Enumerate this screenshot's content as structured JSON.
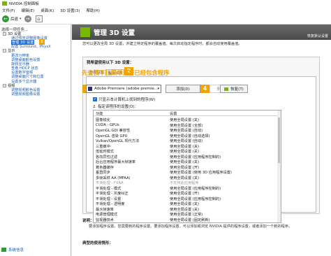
{
  "window": {
    "title": "NVIDIA 控制面板"
  },
  "menu": [
    "文件(F)",
    "编辑(E)",
    "桌面(K)",
    "3D 设置(3)",
    "帮助(H)"
  ],
  "toolbar": {
    "back_label": "后退",
    "forward_arrow": "→",
    "back_arrow": "←"
  },
  "sidebar": {
    "task_label": "选择一项任务...",
    "items": [
      {
        "type": "cat",
        "label": "3D 设置",
        "toggle": "−"
      },
      {
        "type": "child",
        "label": "通过预览调整图像设置"
      },
      {
        "type": "child",
        "label": "管理 3D 设置",
        "selected": true,
        "badge": "1"
      },
      {
        "type": "child",
        "label": "配置 Surround、PhysX"
      },
      {
        "type": "cat",
        "label": "显示",
        "toggle": "−"
      },
      {
        "type": "child",
        "label": "更改分辨率"
      },
      {
        "type": "child",
        "label": "调整桌面颜色设置"
      },
      {
        "type": "child",
        "label": "旋转显示器"
      },
      {
        "type": "child",
        "label": "查看 HDCP 状态"
      },
      {
        "type": "child",
        "label": "设置数字音频"
      },
      {
        "type": "child",
        "label": "调整桌面尺寸和位置"
      },
      {
        "type": "child",
        "label": "设置多个显示器"
      },
      {
        "type": "cat",
        "label": "视频",
        "toggle": "−"
      },
      {
        "type": "child",
        "label": "调整视频颜色设置"
      },
      {
        "type": "child",
        "label": "调整视频图像设置"
      }
    ],
    "system_info": "系统信息"
  },
  "main": {
    "title": "管理 3D 设置",
    "restore_default": "恢复默认设置",
    "description": "您可以更改全局 3D 设置，并建立特定程序的覆盖值。每次启动指定程序时，都会自动使用覆盖值。",
    "panel_heading": "我希望使用以下 3D 设置：",
    "tabs": [
      "全局设置",
      "程序设置"
    ],
    "badges": {
      "tab": "2",
      "select": "3",
      "add": "4"
    },
    "step_text": "先查找下拉菜单是否已经包含程序",
    "select_label": "1. 选择要自定义的程序：",
    "program": "Adobe Premiere (adobe premie...",
    "add_button": "添加(D)",
    "remove_button": "删除(R)",
    "restore_button": "恢复(T)",
    "show_only_checkbox": "只显示本计算机上找到的程序(W)",
    "spec_label": "2. 指定该程序的设置(O)：",
    "table_headers": [
      "功能",
      "设置"
    ],
    "rows": [
      {
        "feature": "图像锐化",
        "setting": "使用全局设置 (关)"
      },
      {
        "feature": "CUDA - GPUs",
        "setting": "使用全局设置 (全部)"
      },
      {
        "feature": "OpenGL GDI 兼容性",
        "setting": "使用全局设置 (自动)"
      },
      {
        "feature": "OpenGL 渲染 GPU",
        "setting": "使用全局设置 (自动选择)"
      },
      {
        "feature": "Vulkan/OpenGL 现代方法",
        "setting": "使用全局设置 (自动)"
      },
      {
        "feature": "三重缓冲",
        "setting": "使用全局设置 (关)"
      },
      {
        "feature": "低延时模式",
        "setting": "使用全局设置 (关)"
      },
      {
        "feature": "各向异性过滤",
        "setting": "使用全局设置 (应用程序控制的)"
      },
      {
        "feature": "后台应用程序最大帧速率",
        "setting": "使用全局设置 (关)"
      },
      {
        "feature": "着色器缓存",
        "setting": "使用全局设置 (开)"
      },
      {
        "feature": "垂直同步",
        "setting": "使用全局设置 (使用 3D 应用程序设置)"
      },
      {
        "feature": "多帧采样 AA (MFAA)",
        "setting": "使用全局设置 (关)"
      },
      {
        "feature": "平滑处理 - FXAA",
        "setting": "不支持此应用程序",
        "dim": true
      },
      {
        "feature": "平滑处理 - 模式",
        "setting": "使用全局设置 (应用程序控制的)"
      },
      {
        "feature": "平滑处理 - 灰度纠正",
        "setting": "使用全局设置 (开)"
      },
      {
        "feature": "平滑处理 - 设置",
        "setting": "使用全局设置 (应用程序控制的)"
      },
      {
        "feature": "平滑处理 - 透明度",
        "setting": "使用全局设置 (关)"
      },
      {
        "feature": "最大帧速率",
        "setting": "使用全局设置 (关)"
      },
      {
        "feature": "电源管理模式",
        "setting": "使用全局设置 (正常)"
      },
      {
        "feature": "监视器技术",
        "setting": "使用全局设置 (固定刷新)"
      },
      {
        "feature": "纹理过滤 - 三线性优化",
        "setting": "使用全局设置 (开)"
      }
    ],
    "explain_title": "说明：",
    "explain_text": "要添加程序设置，您需要新的程序设置。要添加程序设置，可以添加或浏览 NVIDIA 提供的程序设置，或者添加一个新的程序。",
    "typical_title": "典型的使用情形："
  },
  "colors": {
    "accent": "#f2a400",
    "nvidia_green": "#76b900",
    "selection": "#1e6fd9"
  }
}
